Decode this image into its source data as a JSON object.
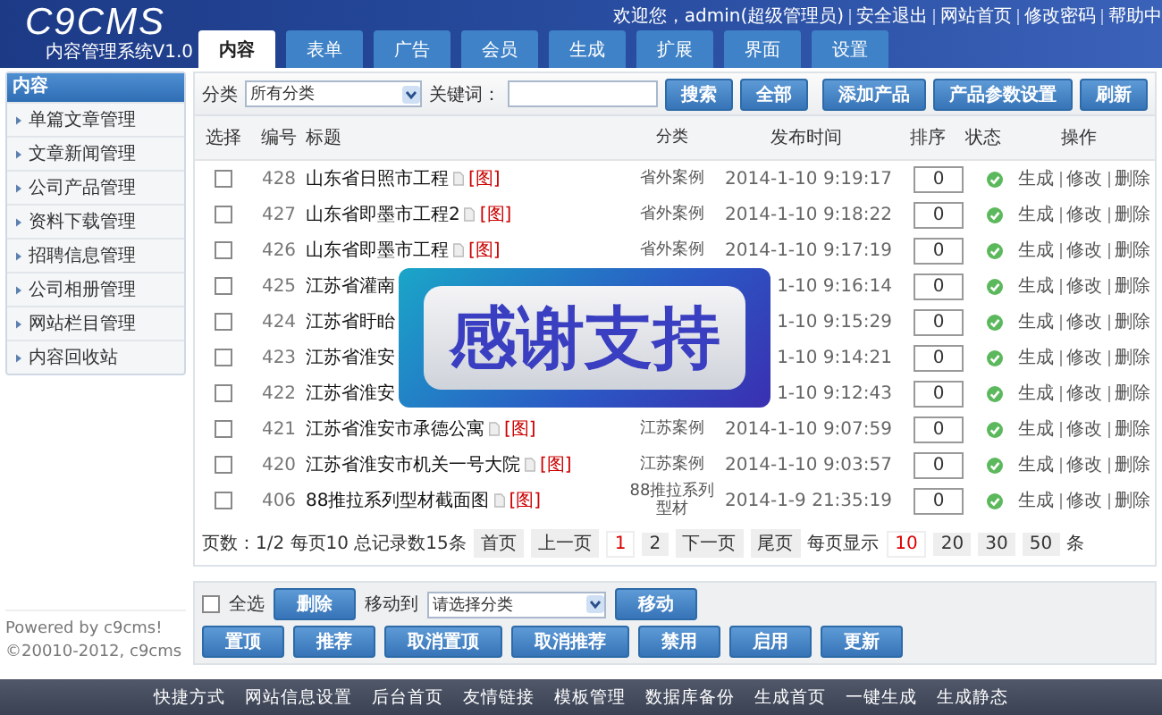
{
  "header": {
    "logo": "C9CMS",
    "subtitle": "内容管理系统V1.0",
    "tabs": [
      {
        "label": "内容",
        "selected": true
      },
      {
        "label": "表单",
        "selected": false
      },
      {
        "label": "广告",
        "selected": false
      },
      {
        "label": "会员",
        "selected": false
      },
      {
        "label": "生成",
        "selected": false
      },
      {
        "label": "扩展",
        "selected": false
      },
      {
        "label": "界面",
        "selected": false
      },
      {
        "label": "设置",
        "selected": false
      }
    ],
    "top_links": [
      "欢迎您，admin(超级管理员)",
      "安全退出",
      "网站首页",
      "修改密码",
      "帮助中"
    ]
  },
  "sidebar": {
    "title": "内容",
    "items": [
      "单篇文章管理",
      "文章新闻管理",
      "公司产品管理",
      "资料下载管理",
      "招聘信息管理",
      "公司相册管理",
      "网站栏目管理",
      "内容回收站"
    ],
    "powered": "Powered by c9cms!",
    "copyright": "©20010-2012, c9cms"
  },
  "filter": {
    "category_label": "分类",
    "category_value": "所有分类",
    "keyword_label": "关键词：",
    "buttons": [
      "搜索",
      "全部"
    ],
    "actions": [
      "添加产品",
      "产品参数设置",
      "刷新"
    ]
  },
  "table": {
    "columns": [
      "选择",
      "编号",
      "标题",
      "分类",
      "发布时间",
      "排序",
      "状态",
      "操作"
    ],
    "rows": [
      {
        "checked": false,
        "id": "428",
        "title": "山东省日照市工程",
        "tag": "[图]",
        "category": "省外案例",
        "date": "2014-1-10 9:19:17",
        "order": "0",
        "enabled": true,
        "ops": [
          "生成",
          "修改",
          "删除"
        ]
      },
      {
        "checked": false,
        "id": "427",
        "title": "山东省即墨市工程2",
        "tag": "[图]",
        "category": "省外案例",
        "date": "2014-1-10 9:18:22",
        "order": "0",
        "enabled": true,
        "ops": [
          "生成",
          "修改",
          "删除"
        ]
      },
      {
        "checked": false,
        "id": "426",
        "title": "山东省即墨市工程",
        "tag": "[图]",
        "category": "省外案例",
        "date": "2014-1-10 9:17:19",
        "order": "0",
        "enabled": true,
        "ops": [
          "生成",
          "修改",
          "删除"
        ]
      },
      {
        "checked": false,
        "id": "425",
        "title": "江苏省灌南",
        "date": "1-10 9:16:14",
        "order": "0",
        "enabled": true,
        "ops": [
          "生成",
          "修改",
          "删除"
        ]
      },
      {
        "checked": false,
        "id": "424",
        "title": "江苏省盱眙",
        "date": "1-10 9:15:29",
        "order": "0",
        "enabled": true,
        "ops": [
          "生成",
          "修改",
          "删除"
        ]
      },
      {
        "checked": false,
        "id": "423",
        "title": "江苏省淮安",
        "date": "1-10 9:14:21",
        "order": "0",
        "enabled": true,
        "ops": [
          "生成",
          "修改",
          "删除"
        ]
      },
      {
        "checked": false,
        "id": "422",
        "title": "江苏省淮安",
        "date": "1-10 9:12:43",
        "order": "0",
        "enabled": true,
        "ops": [
          "生成",
          "修改",
          "删除"
        ]
      },
      {
        "checked": false,
        "id": "421",
        "title": "江苏省淮安市承德公寓",
        "tag": "[图]",
        "category": "江苏案例",
        "date": "2014-1-10 9:07:59",
        "order": "0",
        "enabled": true,
        "ops": [
          "生成",
          "修改",
          "删除"
        ]
      },
      {
        "checked": false,
        "id": "420",
        "title": "江苏省淮安市机关一号大院",
        "tag": "[图]",
        "category": "江苏案例",
        "date": "2014-1-10 9:03:57",
        "order": "0",
        "enabled": true,
        "ops": [
          "生成",
          "修改",
          "删除"
        ]
      },
      {
        "checked": false,
        "id": "406",
        "title": "88推拉系列型材截面图",
        "tag": "[图]",
        "category": "88推拉系列型材",
        "date": "2014-1-9 21:35:19",
        "order": "0",
        "enabled": true,
        "ops": [
          "生成",
          "修改",
          "删除"
        ]
      }
    ]
  },
  "pagination": {
    "info": "页数：1/2 每页10 总记录数15条",
    "pages": [
      {
        "label": "首页",
        "selected": false
      },
      {
        "label": "上一页",
        "selected": false
      },
      {
        "label": "1",
        "selected": true
      },
      {
        "label": "2",
        "selected": false
      },
      {
        "label": "下一页",
        "selected": false
      },
      {
        "label": "尾页",
        "selected": false
      }
    ],
    "per_page_label": "每页显示",
    "per_page": [
      {
        "label": "10",
        "selected": true
      },
      {
        "label": "20",
        "selected": false
      },
      {
        "label": "30",
        "selected": false
      },
      {
        "label": "50",
        "selected": false
      }
    ],
    "suffix": "条"
  },
  "bulk": {
    "select_all": {
      "label": "全选",
      "checked": false
    },
    "delete": "删除",
    "move_label": "移动到",
    "move_select": "请选择分类",
    "move": "移动",
    "buttons": [
      "置顶",
      "推荐",
      "取消置顶",
      "取消推荐",
      "禁用",
      "启用",
      "更新"
    ]
  },
  "overlay": {
    "text": "感谢支持"
  },
  "footer": {
    "links": [
      "快捷方式",
      "网站信息设置",
      "后台首页",
      "友情链接",
      "模板管理",
      "数据库备份",
      "生成首页",
      "一键生成",
      "生成静态"
    ]
  }
}
